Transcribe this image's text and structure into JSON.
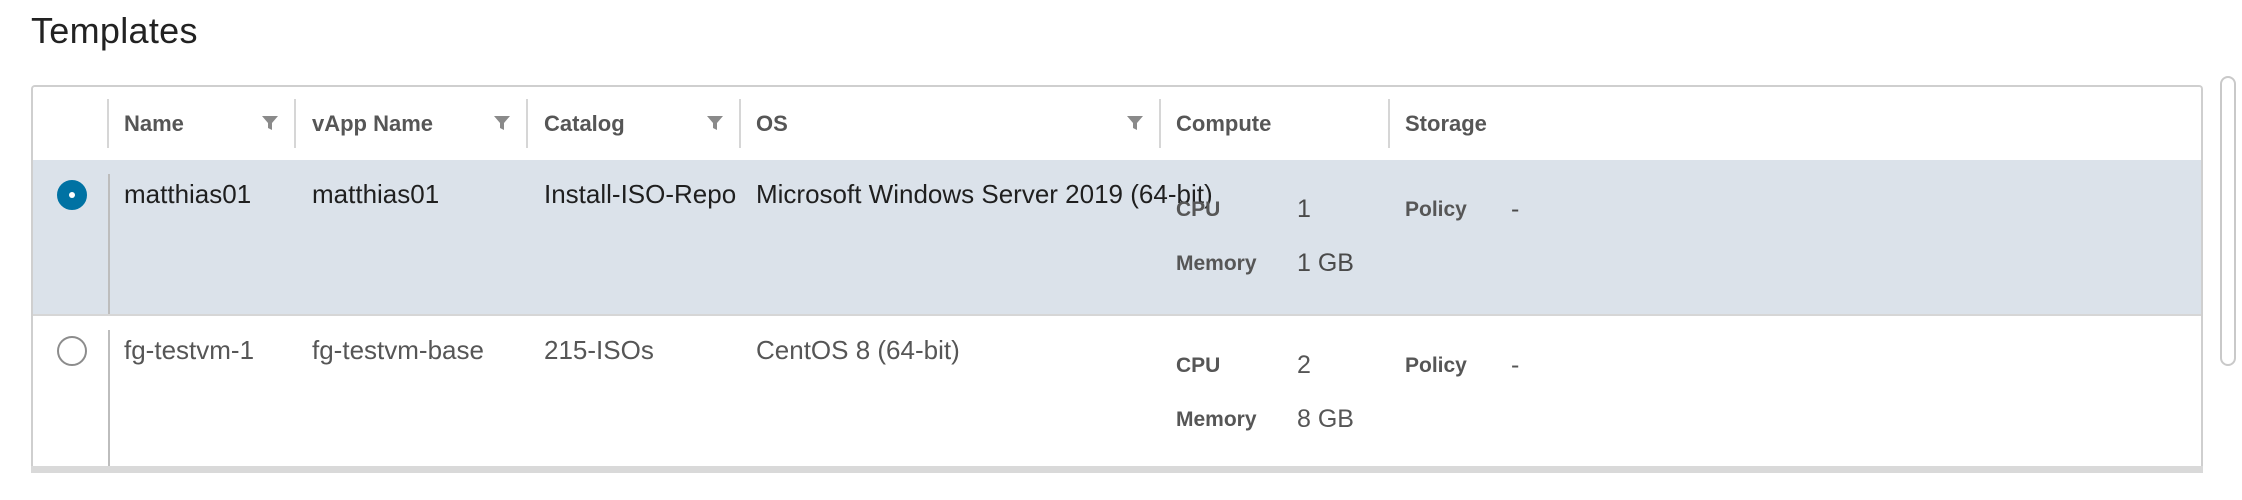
{
  "page": {
    "title": "Templates"
  },
  "table": {
    "columns": [
      {
        "label": "",
        "filterable": false
      },
      {
        "label": "Name",
        "filterable": true
      },
      {
        "label": "vApp Name",
        "filterable": true
      },
      {
        "label": "Catalog",
        "filterable": true
      },
      {
        "label": "OS",
        "filterable": true
      },
      {
        "label": "Compute",
        "filterable": false
      },
      {
        "label": "Storage",
        "filterable": false
      }
    ],
    "rows": [
      {
        "selected": true,
        "name": "matthias01",
        "vapp_name": "matthias01",
        "catalog": "Install-ISO-Repo",
        "os": "Microsoft Windows Server 2019 (64-bit)",
        "compute": {
          "cpu_label": "CPU",
          "cpu": "1",
          "memory_label": "Memory",
          "memory": "1 GB"
        },
        "storage": {
          "policy_label": "Policy",
          "policy": "-"
        }
      },
      {
        "selected": false,
        "name": "fg-testvm-1",
        "vapp_name": "fg-testvm-base",
        "catalog": "215-ISOs",
        "os": "CentOS 8 (64-bit)",
        "compute": {
          "cpu_label": "CPU",
          "cpu": "2",
          "memory_label": "Memory",
          "memory": "8 GB"
        },
        "storage": {
          "policy_label": "Policy",
          "policy": "-"
        }
      }
    ]
  },
  "icons": {
    "filter": "filter-funnel-icon"
  },
  "colors": {
    "accent": "#0072a3",
    "selected_row": "#dbe2ea",
    "border": "#cfcfcf"
  }
}
